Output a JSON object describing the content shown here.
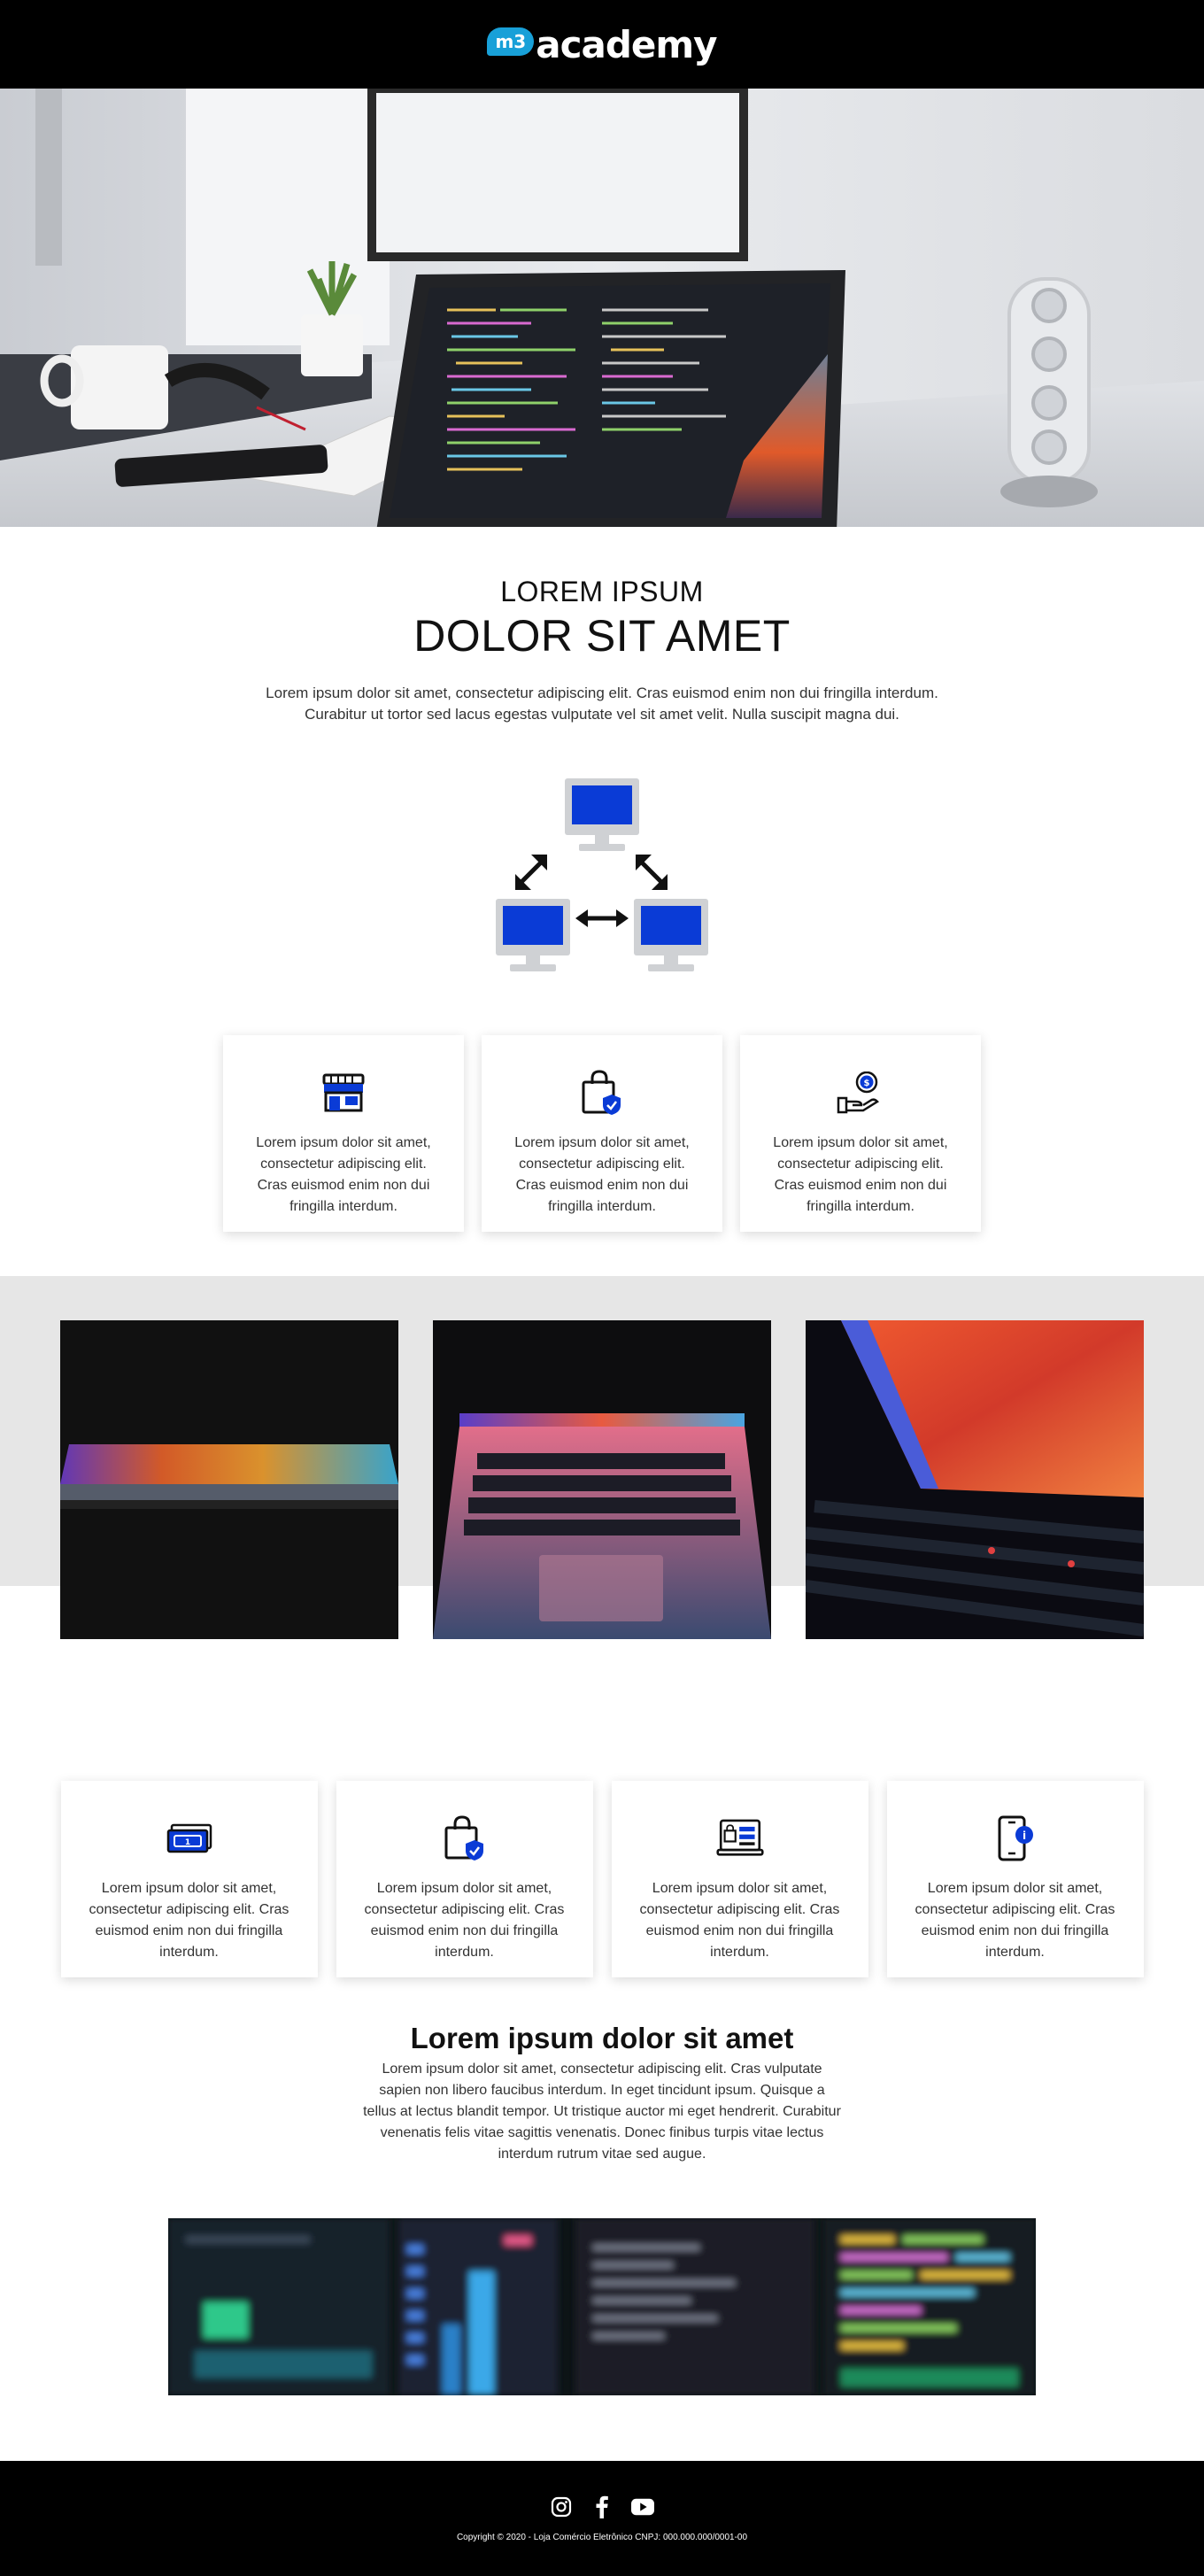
{
  "header": {
    "logo_badge": "m3",
    "logo_text": "academy"
  },
  "intro": {
    "kicker": "LOREM IPSUM",
    "title": "DOLOR SIT AMET",
    "text": "Lorem ipsum dolor sit amet, consectetur adipiscing elit. Cras euismod enim non dui fringilla interdum. Curabitur ut tortor sed lacus egestas vulputate vel sit amet velit. Nulla suscipit magna dui."
  },
  "features_top": [
    {
      "icon": "storefront-icon",
      "text": "Lorem ipsum dolor sit amet, consectetur adipiscing elit. Cras euismod enim non dui fringilla interdum."
    },
    {
      "icon": "secure-shopping-bag-icon",
      "text": "Lorem ipsum dolor sit amet, consectetur adipiscing elit. Cras euismod enim non dui fringilla interdum."
    },
    {
      "icon": "hand-coin-icon",
      "text": "Lorem ipsum dolor sit amet, consectetur adipiscing elit. Cras euismod enim non dui fringilla interdum."
    }
  ],
  "features_bottom": [
    {
      "icon": "cash-icon",
      "text": "Lorem ipsum dolor sit amet, consectetur adipiscing elit. Cras euismod enim non dui fringilla interdum."
    },
    {
      "icon": "secure-shopping-bag-icon",
      "text": "Lorem ipsum dolor sit amet, consectetur adipiscing elit. Cras euismod enim non dui fringilla interdum."
    },
    {
      "icon": "online-store-laptop-icon",
      "text": "Lorem ipsum dolor sit amet, consectetur adipiscing elit. Cras euismod enim non dui fringilla interdum."
    },
    {
      "icon": "mobile-info-icon",
      "text": "Lorem ipsum dolor sit amet, consectetur adipiscing elit. Cras euismod enim non dui fringilla interdum."
    }
  ],
  "article": {
    "title": "Lorem ipsum dolor sit amet",
    "text": "Lorem ipsum dolor sit amet, consectetur adipiscing elit. Cras vulputate sapien non libero faucibus interdum. In eget tincidunt ipsum. Quisque a tellus at lectus blandit tempor. Ut tristique auctor mi eget hendrerit. Curabitur venenatis felis vitae sagittis venenatis. Donec finibus turpis vitae lectus interdum rutrum vitae sed augue."
  },
  "footer": {
    "socials": [
      "instagram-icon",
      "facebook-icon",
      "youtube-icon"
    ],
    "copyright": "Copyright © 2020 - Loja Comércio Eletrônico CNPJ: 000.000.000/0001-00"
  },
  "colors": {
    "accent": "#0a3bd6",
    "header_bg": "#000000",
    "logo_badge": "#18a0d8",
    "gallery_bg": "#e6e6e6"
  }
}
